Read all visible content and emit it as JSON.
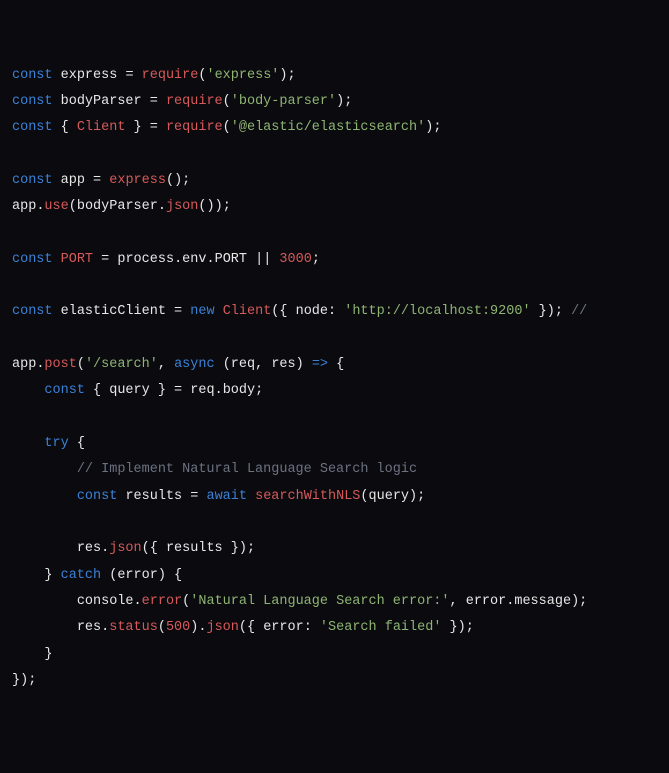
{
  "code": {
    "l1": {
      "kw": "const",
      "id": "express",
      "op1": " = ",
      "fn": "require",
      "paren1": "(",
      "str": "'express'",
      "paren2": ")",
      "semi": ";"
    },
    "l2": {
      "kw": "const",
      "id": "bodyParser",
      "op1": " = ",
      "fn": "require",
      "paren1": "(",
      "str": "'body-parser'",
      "paren2": ")",
      "semi": ";"
    },
    "l3": {
      "kw": "const",
      "brace1": " { ",
      "cls": "Client",
      "brace2": " } = ",
      "fn": "require",
      "paren1": "(",
      "str": "'@elastic/elasticsearch'",
      "paren2": ")",
      "semi": ";"
    },
    "l5": {
      "kw": "const",
      "id": "app",
      "op1": " = ",
      "fn": "express",
      "paren": "()",
      "semi": ";"
    },
    "l6": {
      "id1": "app",
      "dot1": ".",
      "fn1": "use",
      "paren1": "(",
      "id2": "bodyParser",
      "dot2": ".",
      "fn2": "json",
      "paren2": "())",
      "semi": ";"
    },
    "l8": {
      "kw": "const",
      "id": "PORT",
      "op1": " = ",
      "id2": "process",
      "dot1": ".",
      "id3": "env",
      "dot2": ".",
      "id4": "PORT",
      "op2": " || ",
      "num": "3000",
      "semi": ";"
    },
    "l10": {
      "kw": "const",
      "id": "elasticClient",
      "op1": " = ",
      "kw2": "new",
      "sp": " ",
      "cls": "Client",
      "paren1": "({ ",
      "key": "node",
      "colon": ": ",
      "str": "'http://localhost:9200'",
      "paren2": " })",
      "semi": ";",
      "cmt": " //"
    },
    "l12": {
      "id1": "app",
      "dot1": ".",
      "fn1": "post",
      "paren1": "(",
      "str": "'/search'",
      "comma": ", ",
      "kw1": "async",
      "sp": " ",
      "paren2": "(",
      "id2": "req",
      "comma2": ", ",
      "id3": "res",
      "paren3": ") ",
      "arrow": "=>",
      "brace": " {"
    },
    "l13": {
      "indent": "    ",
      "kw": "const",
      "brace1": " { ",
      "id": "query",
      "brace2": " } = ",
      "id2": "req",
      "dot": ".",
      "id3": "body",
      "semi": ";"
    },
    "l15": {
      "indent": "    ",
      "kw": "try",
      "brace": " {"
    },
    "l16": {
      "indent": "        ",
      "cmt": "// Implement Natural Language Search logic"
    },
    "l17": {
      "indent": "        ",
      "kw": "const",
      "id": "results",
      "op1": " = ",
      "kw2": "await",
      "sp": " ",
      "fn": "searchWithNLS",
      "paren1": "(",
      "id2": "query",
      "paren2": ")",
      "semi": ";"
    },
    "l19": {
      "indent": "        ",
      "id1": "res",
      "dot": ".",
      "fn": "json",
      "paren1": "({ ",
      "id2": "results",
      "paren2": " })",
      "semi": ";"
    },
    "l20": {
      "indent": "    ",
      "brace1": "} ",
      "kw": "catch",
      "paren1": " (",
      "id": "error",
      "paren2": ") {"
    },
    "l21": {
      "indent": "        ",
      "id1": "console",
      "dot": ".",
      "fn": "error",
      "paren1": "(",
      "str": "'Natural Language Search error:'",
      "comma": ", ",
      "id2": "error",
      "dot2": ".",
      "id3": "message",
      "paren2": ")",
      "semi": ";"
    },
    "l22": {
      "indent": "        ",
      "id1": "res",
      "dot1": ".",
      "fn1": "status",
      "paren1": "(",
      "num": "500",
      "paren2": ")",
      "dot2": ".",
      "fn2": "json",
      "paren3": "({ ",
      "key": "error",
      "colon": ": ",
      "str": "'Search failed'",
      "paren4": " })",
      "semi": ";"
    },
    "l23": {
      "indent": "    ",
      "brace": "}"
    },
    "l24": {
      "brace": "})",
      "semi": ";"
    }
  }
}
